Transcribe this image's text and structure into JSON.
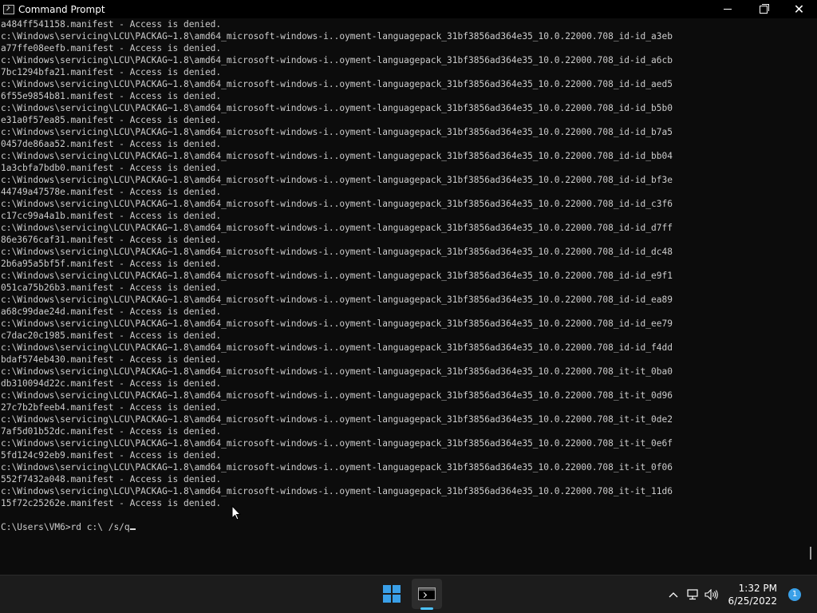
{
  "window": {
    "title": "Command Prompt",
    "minimize": "—",
    "maximize": "☐",
    "close": "✕"
  },
  "console": {
    "lines": [
      "a484ff541158.manifest - Access is denied.",
      "c:\\Windows\\servicing\\LCU\\PACKAG~1.8\\amd64_microsoft-windows-i..oyment-languagepack_31bf3856ad364e35_10.0.22000.708_id-id_a3eb",
      "a77ffe08eefb.manifest - Access is denied.",
      "c:\\Windows\\servicing\\LCU\\PACKAG~1.8\\amd64_microsoft-windows-i..oyment-languagepack_31bf3856ad364e35_10.0.22000.708_id-id_a6cb",
      "7bc1294bfa21.manifest - Access is denied.",
      "c:\\Windows\\servicing\\LCU\\PACKAG~1.8\\amd64_microsoft-windows-i..oyment-languagepack_31bf3856ad364e35_10.0.22000.708_id-id_aed5",
      "6f55e9854b81.manifest - Access is denied.",
      "c:\\Windows\\servicing\\LCU\\PACKAG~1.8\\amd64_microsoft-windows-i..oyment-languagepack_31bf3856ad364e35_10.0.22000.708_id-id_b5b0",
      "e31a0f57ea85.manifest - Access is denied.",
      "c:\\Windows\\servicing\\LCU\\PACKAG~1.8\\amd64_microsoft-windows-i..oyment-languagepack_31bf3856ad364e35_10.0.22000.708_id-id_b7a5",
      "0457de86aa52.manifest - Access is denied.",
      "c:\\Windows\\servicing\\LCU\\PACKAG~1.8\\amd64_microsoft-windows-i..oyment-languagepack_31bf3856ad364e35_10.0.22000.708_id-id_bb04",
      "1a3cbfa7bdb0.manifest - Access is denied.",
      "c:\\Windows\\servicing\\LCU\\PACKAG~1.8\\amd64_microsoft-windows-i..oyment-languagepack_31bf3856ad364e35_10.0.22000.708_id-id_bf3e",
      "44749a47578e.manifest - Access is denied.",
      "c:\\Windows\\servicing\\LCU\\PACKAG~1.8\\amd64_microsoft-windows-i..oyment-languagepack_31bf3856ad364e35_10.0.22000.708_id-id_c3f6",
      "c17cc99a4a1b.manifest - Access is denied.",
      "c:\\Windows\\servicing\\LCU\\PACKAG~1.8\\amd64_microsoft-windows-i..oyment-languagepack_31bf3856ad364e35_10.0.22000.708_id-id_d7ff",
      "86e3676caf31.manifest - Access is denied.",
      "c:\\Windows\\servicing\\LCU\\PACKAG~1.8\\amd64_microsoft-windows-i..oyment-languagepack_31bf3856ad364e35_10.0.22000.708_id-id_dc48",
      "2b6a95a5bf5f.manifest - Access is denied.",
      "c:\\Windows\\servicing\\LCU\\PACKAG~1.8\\amd64_microsoft-windows-i..oyment-languagepack_31bf3856ad364e35_10.0.22000.708_id-id_e9f1",
      "051ca75b26b3.manifest - Access is denied.",
      "c:\\Windows\\servicing\\LCU\\PACKAG~1.8\\amd64_microsoft-windows-i..oyment-languagepack_31bf3856ad364e35_10.0.22000.708_id-id_ea89",
      "a68c99dae24d.manifest - Access is denied.",
      "c:\\Windows\\servicing\\LCU\\PACKAG~1.8\\amd64_microsoft-windows-i..oyment-languagepack_31bf3856ad364e35_10.0.22000.708_id-id_ee79",
      "c7dac20c1985.manifest - Access is denied.",
      "c:\\Windows\\servicing\\LCU\\PACKAG~1.8\\amd64_microsoft-windows-i..oyment-languagepack_31bf3856ad364e35_10.0.22000.708_id-id_f4dd",
      "bdaf574eb430.manifest - Access is denied.",
      "c:\\Windows\\servicing\\LCU\\PACKAG~1.8\\amd64_microsoft-windows-i..oyment-languagepack_31bf3856ad364e35_10.0.22000.708_it-it_0ba0",
      "db310094d22c.manifest - Access is denied.",
      "c:\\Windows\\servicing\\LCU\\PACKAG~1.8\\amd64_microsoft-windows-i..oyment-languagepack_31bf3856ad364e35_10.0.22000.708_it-it_0d96",
      "27c7b2bfeeb4.manifest - Access is denied.",
      "c:\\Windows\\servicing\\LCU\\PACKAG~1.8\\amd64_microsoft-windows-i..oyment-languagepack_31bf3856ad364e35_10.0.22000.708_it-it_0de2",
      "7af5d01b52dc.manifest - Access is denied.",
      "c:\\Windows\\servicing\\LCU\\PACKAG~1.8\\amd64_microsoft-windows-i..oyment-languagepack_31bf3856ad364e35_10.0.22000.708_it-it_0e6f",
      "5fd124c92eb9.manifest - Access is denied.",
      "c:\\Windows\\servicing\\LCU\\PACKAG~1.8\\amd64_microsoft-windows-i..oyment-languagepack_31bf3856ad364e35_10.0.22000.708_it-it_0f06",
      "552f7432a048.manifest - Access is denied.",
      "c:\\Windows\\servicing\\LCU\\PACKAG~1.8\\amd64_microsoft-windows-i..oyment-languagepack_31bf3856ad364e35_10.0.22000.708_it-it_11d6",
      "15f72c25262e.manifest - Access is denied.",
      ""
    ],
    "prompt": "C:\\Users\\VM6>rd c:\\ /s/q"
  },
  "taskbar": {
    "start_icon": "windows-start-icon",
    "app_icon": "command-prompt-icon",
    "tray": {
      "chevron": "^",
      "network_icon": "network-icon",
      "volume_icon": "volume-icon",
      "time": "1:32 PM",
      "date": "6/25/2022",
      "notification_count": "1"
    }
  }
}
